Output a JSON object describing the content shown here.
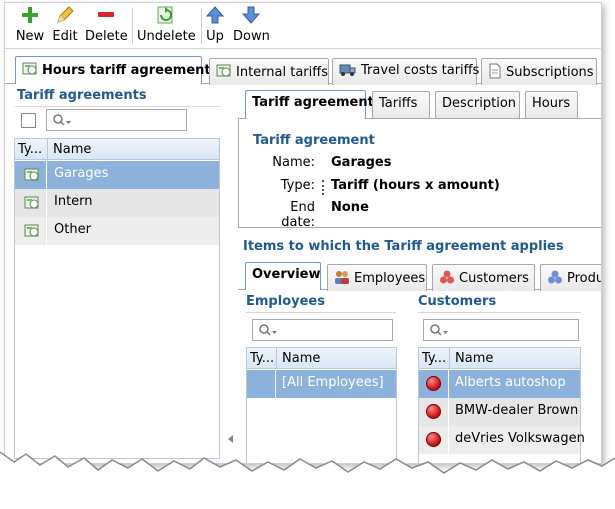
{
  "toolbar": {
    "new": "New",
    "edit": "Edit",
    "delete": "Delete",
    "undelete": "Undelete",
    "up": "Up",
    "down": "Down"
  },
  "main_tabs": [
    "Hours tariff agreements",
    "Internal tariffs",
    "Travel costs tariffs",
    "Subscriptions"
  ],
  "left": {
    "title": "Tariff agreements",
    "columns": [
      "Ty...",
      "Name"
    ],
    "rows": [
      "Garages",
      "Intern",
      "Other"
    ]
  },
  "detail_tabs": [
    "Tariff agreement",
    "Tariffs",
    "Description",
    "Hours"
  ],
  "detail": {
    "title": "Tariff agreement",
    "name_label": "Name:",
    "name_value": "Garages",
    "type_label": "Type:",
    "type_value": "Tariff (hours x amount)",
    "enddate_label": "End date:",
    "enddate_value": "None"
  },
  "applies": {
    "title": "Items to which the Tariff agreement applies",
    "tabs": [
      "Overview",
      "Employees",
      "Customers",
      "Produ"
    ]
  },
  "employees": {
    "title": "Employees",
    "columns": [
      "Ty...",
      "Name"
    ],
    "rows": [
      "[All Employees]"
    ]
  },
  "customers": {
    "title": "Customers",
    "columns": [
      "Ty...",
      "Name"
    ],
    "rows": [
      "Alberts autoshop",
      "BMW-dealer Brown",
      "deVries Volkswagen"
    ]
  },
  "colors": {
    "accent": "#1f5a93",
    "selection": "#8cb2db",
    "status_red": "#d11a1a"
  }
}
